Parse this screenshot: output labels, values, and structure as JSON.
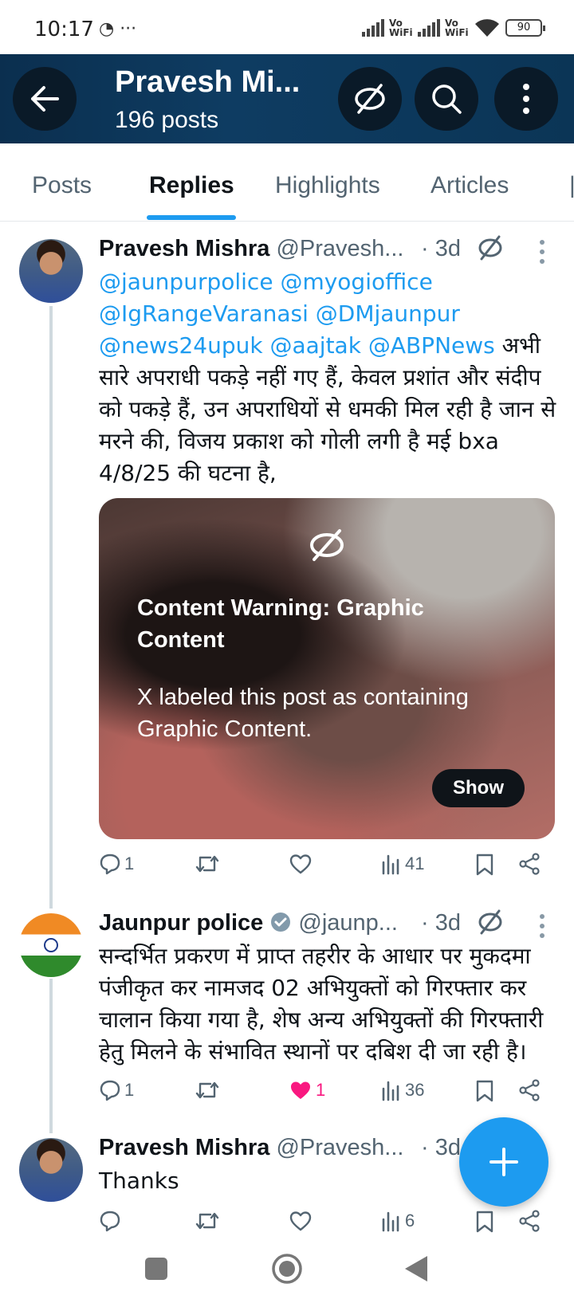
{
  "status_bar": {
    "time": "10:17",
    "left_icons": "◔ ···",
    "vo_wifi_1": "Vo WiFi",
    "vo_wifi_2": "Vo WiFi",
    "battery": "90"
  },
  "header": {
    "title": "Pravesh Mi...",
    "subtitle": "196 posts"
  },
  "tabs": [
    {
      "label": "Posts"
    },
    {
      "label": "Replies"
    },
    {
      "label": "Highlights"
    },
    {
      "label": "Articles"
    }
  ],
  "active_tab": "Replies",
  "tweets": [
    {
      "name": "Pravesh Mishra",
      "handle": "@Pravesh...",
      "time": "· 3d",
      "mentions": "@jaunpurpolice @myogioffice @IgRangeVaranasi @DMjaunpur @news24upuk @aajtak @ABPNews",
      "text": "अभी सारे अपराधी पकड़े नहीं गए हैं, केवल प्रशांत और संदीप को पकड़े हैं, उन अपराधियों से धमकी मिल रही है जान से मरने की, विजय प्रकाश को गोली लगी है मई bxa 4/8/25 की घटना है,",
      "media_warning": {
        "title": "Content Warning: Graphic Content",
        "description": "X labeled this post as containing Graphic Content.",
        "button": "Show"
      },
      "replies": "1",
      "reposts": "",
      "likes": "",
      "views": "41"
    },
    {
      "name": "Jaunpur police",
      "verified": true,
      "handle": "@jaunp...",
      "time": "· 3d",
      "text": "सन्दर्भित प्रकरण में प्राप्त तहरीर के आधार पर मुकदमा पंजीकृत कर नामजद 02 अभियुक्तों को गिरफ्तार कर चालान किया गया है, शेष अन्य अभियुक्तों की गिरफ्तारी हेतु मिलने के संभावित स्थानों पर दबिश दी जा रही है।",
      "replies": "1",
      "reposts": "",
      "likes": "1",
      "views": "36"
    },
    {
      "name": "Pravesh Mishra",
      "handle": "@Pravesh...",
      "time": "· 3d",
      "text": "Thanks",
      "replies": "",
      "reposts": "",
      "likes": "",
      "views": "6"
    }
  ],
  "colors": {
    "accent": "#1d9bf0",
    "header_bg": "#0e3c62",
    "like": "#f91880"
  }
}
